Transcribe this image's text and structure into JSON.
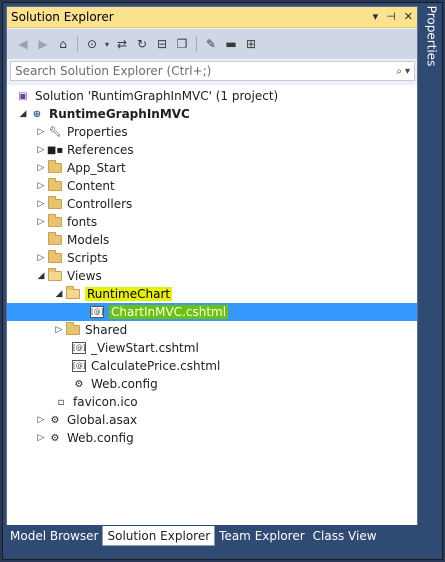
{
  "window": {
    "title": "Solution Explorer",
    "side_tab_label": "Properties"
  },
  "search": {
    "placeholder": "Search Solution Explorer (Ctrl+;)"
  },
  "tree": {
    "solution_label": "Solution 'RuntimGraphInMVC' (1 project)",
    "project_label": "RuntimeGraphInMVC",
    "properties_label": "Properties",
    "references_label": "References",
    "app_start_label": "App_Start",
    "content_label": "Content",
    "controllers_label": "Controllers",
    "fonts_label": "fonts",
    "models_label": "Models",
    "scripts_label": "Scripts",
    "views_label": "Views",
    "runtimechart_label": "RuntimeChart",
    "chartinmvc_label": "ChartInMVC.cshtml",
    "shared_label": "Shared",
    "viewstart_label": "_ViewStart.cshtml",
    "calculateprice_label": "CalculatePrice.cshtml",
    "views_webconfig_label": "Web.config",
    "favicon_label": "favicon.ico",
    "global_asax_label": "Global.asax",
    "root_webconfig_label": "Web.config"
  },
  "bottom_tabs": {
    "model_browser": "Model Browser",
    "solution_explorer": "Solution Explorer",
    "team_explorer": "Team Explorer",
    "class_view": "Class View"
  },
  "colors": {
    "title_bar": "#fbe28e",
    "selection": "#3399ff",
    "highlight_yellow": "#e8f00a",
    "highlight_green": "#6cc20b"
  }
}
